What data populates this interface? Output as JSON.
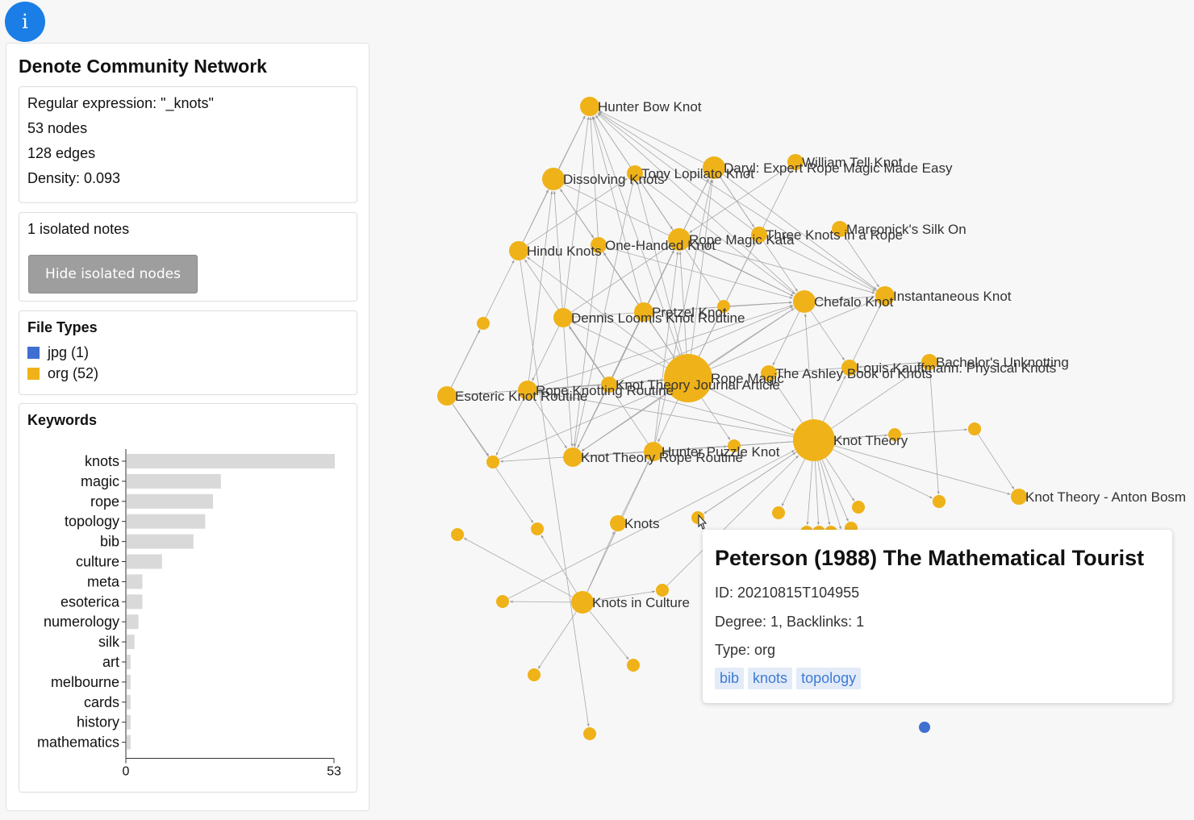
{
  "info_button": {
    "label": "i"
  },
  "sidebar": {
    "title": "Denote Community Network",
    "stats": {
      "regex": "Regular expression: \"_knots\"",
      "nodes": "53 nodes",
      "edges": "128 edges",
      "density": "Density: 0.093"
    },
    "isolated": {
      "text": "1 isolated notes",
      "button_label": "Hide isolated nodes"
    },
    "file_types": {
      "title": "File Types",
      "items": [
        {
          "label": "jpg (1)",
          "color": "#3f6fd1"
        },
        {
          "label": "org (52)",
          "color": "#efb218"
        }
      ]
    },
    "keywords": {
      "title": "Keywords",
      "chart_data": {
        "type": "bar",
        "orientation": "horizontal",
        "categories": [
          "knots",
          "magic",
          "rope",
          "topology",
          "bib",
          "culture",
          "meta",
          "esoterica",
          "numerology",
          "silk",
          "art",
          "melbourne",
          "cards",
          "history",
          "mathematics"
        ],
        "values": [
          53,
          24,
          22,
          20,
          17,
          9,
          4,
          4,
          3,
          2,
          1,
          1,
          1,
          1,
          1
        ],
        "xlim": [
          0,
          53
        ],
        "tick_labels": [
          "0",
          "53"
        ],
        "bar_color": "#d9d9d9"
      }
    }
  },
  "network": {
    "org_color": "#efb218",
    "jpg_color": "#3f6fd1",
    "nodes": [
      {
        "id": "hunter-bow",
        "label": "Hunter Bow Knot",
        "size": "m"
      },
      {
        "id": "dissolving",
        "label": "Dissolving Knots",
        "size": "l"
      },
      {
        "id": "tony",
        "label": "Tony Lopilato Knot",
        "size": "s"
      },
      {
        "id": "daryl",
        "label": "Daryl: Expert Rope Magic Made Easy",
        "size": "l"
      },
      {
        "id": "william",
        "label": "William Tell Knot",
        "size": "s"
      },
      {
        "id": "hindu",
        "label": "Hindu Knots",
        "size": "m"
      },
      {
        "id": "onehanded",
        "label": "One-Handed Knot",
        "size": "s"
      },
      {
        "id": "ropemagickata",
        "label": "Rope Magic Kata",
        "size": "l"
      },
      {
        "id": "threeknots",
        "label": "Three Knots in a Rope",
        "size": "s"
      },
      {
        "id": "marconick",
        "label": "Marconick's Silk On",
        "size": "s"
      },
      {
        "id": "instantaneous",
        "label": "Instantaneous Knot",
        "size": "m"
      },
      {
        "id": "chefalo",
        "label": "Chefalo Knot",
        "size": "l"
      },
      {
        "id": "dennis",
        "label": "Dennis Loomis Knot Routine",
        "size": "m"
      },
      {
        "id": "pretzel",
        "label": "Pretzel Knot",
        "size": "m"
      },
      {
        "id": "n-a",
        "label": "",
        "size": "xs"
      },
      {
        "id": "n-b",
        "label": "",
        "size": "xs"
      },
      {
        "id": "ropemagic",
        "label": "Rope Magic",
        "size": "xxl"
      },
      {
        "id": "esoteric",
        "label": "Esoteric Knot Routine",
        "size": "m"
      },
      {
        "id": "ropeknotting",
        "label": "Rope Knotting Routine",
        "size": "m"
      },
      {
        "id": "ktjournal",
        "label": "Knot Theory Journal Article",
        "size": "s"
      },
      {
        "id": "ashley",
        "label": "The Ashley Book of Knots",
        "size": "s"
      },
      {
        "id": "kauffman",
        "label": "Louis Kauffmann: Physical Knots",
        "size": "s"
      },
      {
        "id": "bachelor",
        "label": "Bachelor's Unknotting",
        "size": "s"
      },
      {
        "id": "knottheory",
        "label": "Knot Theory",
        "size": "xl"
      },
      {
        "id": "n-c",
        "label": "",
        "size": "xs"
      },
      {
        "id": "n-d",
        "label": "",
        "size": "xs"
      },
      {
        "id": "hunterpuzzle",
        "label": "Hunter Puzzle Knot",
        "size": "m"
      },
      {
        "id": "ktrope",
        "label": "Knot Theory Rope Routine",
        "size": "m"
      },
      {
        "id": "n-e",
        "label": "",
        "size": "xs"
      },
      {
        "id": "anton",
        "label": "Knot Theory - Anton Bosm",
        "size": "s"
      },
      {
        "id": "n-f",
        "label": "",
        "size": "xs"
      },
      {
        "id": "knots",
        "label": "Knots",
        "size": "s"
      },
      {
        "id": "peterson",
        "label": "",
        "size": "xs"
      },
      {
        "id": "n-g",
        "label": "",
        "size": "xs"
      },
      {
        "id": "n-h",
        "label": "",
        "size": "xs"
      },
      {
        "id": "n-i",
        "label": "",
        "size": "xs"
      },
      {
        "id": "n-j",
        "label": "",
        "size": "xs"
      },
      {
        "id": "n-k",
        "label": "",
        "size": "xs"
      },
      {
        "id": "knotsculture",
        "label": "Knots in Culture",
        "size": "l"
      },
      {
        "id": "n-l",
        "label": "",
        "size": "xs"
      },
      {
        "id": "n-m",
        "label": "",
        "size": "xs"
      },
      {
        "id": "n-n",
        "label": "",
        "size": "xs"
      },
      {
        "id": "n-o",
        "label": "",
        "size": "xs"
      },
      {
        "id": "n-p",
        "label": "",
        "size": "xs"
      },
      {
        "id": "n-q",
        "label": "",
        "size": "xs"
      },
      {
        "id": "n-r",
        "label": "",
        "size": "xs"
      },
      {
        "id": "n-s",
        "label": "",
        "size": "xs"
      },
      {
        "id": "n-t",
        "label": "",
        "size": "xs"
      },
      {
        "id": "n-u",
        "label": "",
        "size": "xs"
      },
      {
        "id": "n-v",
        "label": "",
        "size": "xs"
      },
      {
        "id": "n-w",
        "label": "",
        "size": "xs"
      },
      {
        "id": "n-x",
        "label": "",
        "size": "xs"
      },
      {
        "id": "jpg",
        "label": "",
        "size": "xs",
        "type": "jpg"
      }
    ],
    "edges": [
      [
        "dissolving",
        "hunter-bow"
      ],
      [
        "tony",
        "hunter-bow"
      ],
      [
        "daryl",
        "hunter-bow"
      ],
      [
        "hindu",
        "hunter-bow"
      ],
      [
        "onehanded",
        "hunter-bow"
      ],
      [
        "ropemagickata",
        "hunter-bow"
      ],
      [
        "threeknots",
        "hunter-bow"
      ],
      [
        "instantaneous",
        "hunter-bow"
      ],
      [
        "chefalo",
        "hunter-bow"
      ],
      [
        "dennis",
        "hunter-bow"
      ],
      [
        "ropemagic",
        "hunter-bow"
      ],
      [
        "pretzel",
        "hunter-bow"
      ],
      [
        "ropemagic",
        "daryl"
      ],
      [
        "ropemagic",
        "dissolving"
      ],
      [
        "ropemagic",
        "tony"
      ],
      [
        "ropemagic",
        "ropemagickata"
      ],
      [
        "ropemagic",
        "onehanded"
      ],
      [
        "ropemagic",
        "threeknots"
      ],
      [
        "ropemagic",
        "chefalo"
      ],
      [
        "ropemagic",
        "instantaneous"
      ],
      [
        "ropemagic",
        "pretzel"
      ],
      [
        "ropemagic",
        "dennis"
      ],
      [
        "ropemagic",
        "n-a"
      ],
      [
        "ropemagic",
        "esoteric"
      ],
      [
        "ropemagic",
        "ropeknotting"
      ],
      [
        "ropemagic",
        "ktjournal"
      ],
      [
        "ropemagic",
        "knottheory"
      ],
      [
        "ropemagic",
        "hunterpuzzle"
      ],
      [
        "ropemagic",
        "ktrope"
      ],
      [
        "ropemagic",
        "william"
      ],
      [
        "ropemagic",
        "hindu"
      ],
      [
        "ropemagic",
        "n-d"
      ],
      [
        "knottheory",
        "ashley"
      ],
      [
        "knottheory",
        "kauffman"
      ],
      [
        "knottheory",
        "bachelor"
      ],
      [
        "knottheory",
        "anton"
      ],
      [
        "knottheory",
        "n-c"
      ],
      [
        "knottheory",
        "n-e"
      ],
      [
        "knottheory",
        "n-f"
      ],
      [
        "knottheory",
        "n-g"
      ],
      [
        "knottheory",
        "n-h"
      ],
      [
        "knottheory",
        "n-i"
      ],
      [
        "knottheory",
        "peterson"
      ],
      [
        "knottheory",
        "chefalo"
      ],
      [
        "knottheory",
        "ktjournal"
      ],
      [
        "knottheory",
        "ktrope"
      ],
      [
        "knottheory",
        "n-t"
      ],
      [
        "knottheory",
        "n-u"
      ],
      [
        "knottheory",
        "n-v"
      ],
      [
        "knottheory",
        "n-w"
      ],
      [
        "knottheory",
        "n-x"
      ],
      [
        "knottheory",
        "hunterpuzzle"
      ],
      [
        "knottheory",
        "ropeknotting"
      ],
      [
        "knotsculture",
        "n-j"
      ],
      [
        "knotsculture",
        "n-k"
      ],
      [
        "knotsculture",
        "n-l"
      ],
      [
        "knotsculture",
        "n-m"
      ],
      [
        "knotsculture",
        "n-n"
      ],
      [
        "knotsculture",
        "n-o"
      ],
      [
        "knotsculture",
        "knots"
      ],
      [
        "knotsculture",
        "hunterpuzzle"
      ],
      [
        "esoteric",
        "hindu"
      ],
      [
        "esoteric",
        "n-b"
      ],
      [
        "esoteric",
        "n-k"
      ],
      [
        "esoteric",
        "ropemagic"
      ],
      [
        "hindu",
        "n-p"
      ],
      [
        "hindu",
        "dissolving"
      ],
      [
        "hindu",
        "tony"
      ],
      [
        "dennis",
        "ropemagickata"
      ],
      [
        "dennis",
        "chefalo"
      ],
      [
        "dennis",
        "dissolving"
      ],
      [
        "pretzel",
        "onehanded"
      ],
      [
        "pretzel",
        "ropemagickata"
      ],
      [
        "pretzel",
        "chefalo"
      ],
      [
        "ropeknotting",
        "ktrope"
      ],
      [
        "ropeknotting",
        "dissolving"
      ],
      [
        "ropeknotting",
        "ktjournal"
      ],
      [
        "ropeknotting",
        "chefalo"
      ],
      [
        "ropeknotting",
        "n-q"
      ],
      [
        "ktjournal",
        "ropemagickata"
      ],
      [
        "ktjournal",
        "ktrope"
      ],
      [
        "ktjournal",
        "dennis"
      ],
      [
        "ktjournal",
        "chefalo"
      ],
      [
        "ktjournal",
        "daryl"
      ],
      [
        "daryl",
        "threeknots"
      ],
      [
        "daryl",
        "instantaneous"
      ],
      [
        "daryl",
        "chefalo"
      ],
      [
        "tony",
        "chefalo"
      ],
      [
        "tony",
        "ropemagickata"
      ],
      [
        "william",
        "ropemagickata"
      ],
      [
        "marconick",
        "instantaneous"
      ],
      [
        "threeknots",
        "instantaneous"
      ],
      [
        "ropemagickata",
        "instantaneous"
      ],
      [
        "ropemagickata",
        "chefalo"
      ],
      [
        "onehanded",
        "chefalo"
      ],
      [
        "dissolving",
        "chefalo"
      ],
      [
        "dissolving",
        "onehanded"
      ],
      [
        "chefalo",
        "kauffman"
      ],
      [
        "chefalo",
        "ashley"
      ],
      [
        "chefalo",
        "ktrope"
      ],
      [
        "chefalo",
        "instantaneous"
      ],
      [
        "bachelor",
        "n-r"
      ],
      [
        "bachelor",
        "kauffman"
      ],
      [
        "n-s",
        "anton"
      ],
      [
        "n-c",
        "knottheory"
      ],
      [
        "esoteric",
        "n-q"
      ],
      [
        "ktrope",
        "ropemagickata"
      ],
      [
        "ktrope",
        "tony"
      ],
      [
        "ktrope",
        "daryl"
      ],
      [
        "hunterpuzzle",
        "ropemagickata"
      ],
      [
        "hunterpuzzle",
        "daryl"
      ],
      [
        "hunterpuzzle",
        "dennis"
      ],
      [
        "hunterpuzzle",
        "n-d"
      ],
      [
        "knots",
        "hunterpuzzle"
      ],
      [
        "n-m",
        "knottheory"
      ],
      [
        "n-l",
        "knottheory"
      ],
      [
        "peterson",
        "knottheory"
      ],
      [
        "n-f",
        "ropemagic"
      ],
      [
        "dennis",
        "ktrope"
      ],
      [
        "dennis",
        "ropeknotting"
      ],
      [
        "n-a",
        "chefalo"
      ],
      [
        "n-a",
        "tony"
      ],
      [
        "kauffman",
        "instantaneous"
      ],
      [
        "ashley",
        "bachelor"
      ],
      [
        "ktjournal",
        "hindu"
      ],
      [
        "onehanded",
        "ktrope"
      ]
    ]
  },
  "tooltip": {
    "title": "Peterson (1988) The Mathematical Tourist",
    "id": "ID: 20210815T104955",
    "degree": "Degree: 1, Backlinks: 1",
    "type": "Type: org",
    "tags": [
      "bib",
      "knots",
      "topology"
    ]
  }
}
